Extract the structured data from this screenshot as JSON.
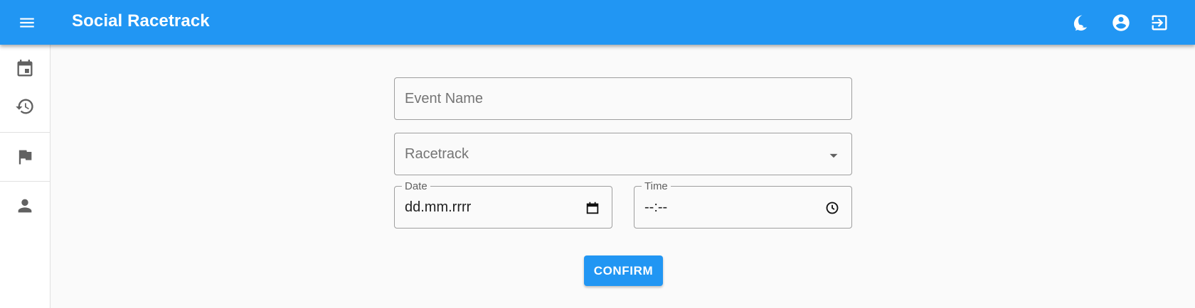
{
  "app": {
    "title": "Social Racetrack"
  },
  "topbar": {
    "menu_icon": "menu-icon",
    "actions": [
      {
        "icon": "dark-mode-icon"
      },
      {
        "icon": "account-circle-icon"
      },
      {
        "icon": "logout-icon"
      }
    ]
  },
  "sidebar": {
    "items": [
      {
        "icon": "calendar-icon"
      },
      {
        "icon": "history-icon"
      },
      {
        "icon": "flag-icon"
      },
      {
        "icon": "person-icon"
      }
    ]
  },
  "form": {
    "event_name": {
      "placeholder": "Event Name",
      "value": ""
    },
    "racetrack": {
      "placeholder": "Racetrack",
      "value": ""
    },
    "date": {
      "label": "Date",
      "value": "dd.mm.rrrr"
    },
    "time": {
      "label": "Time",
      "value": "--:--"
    },
    "confirm_label": "CONFIRM"
  },
  "colors": {
    "primary": "#2196f3",
    "background": "#fafafa",
    "icon_grey": "#616161"
  }
}
